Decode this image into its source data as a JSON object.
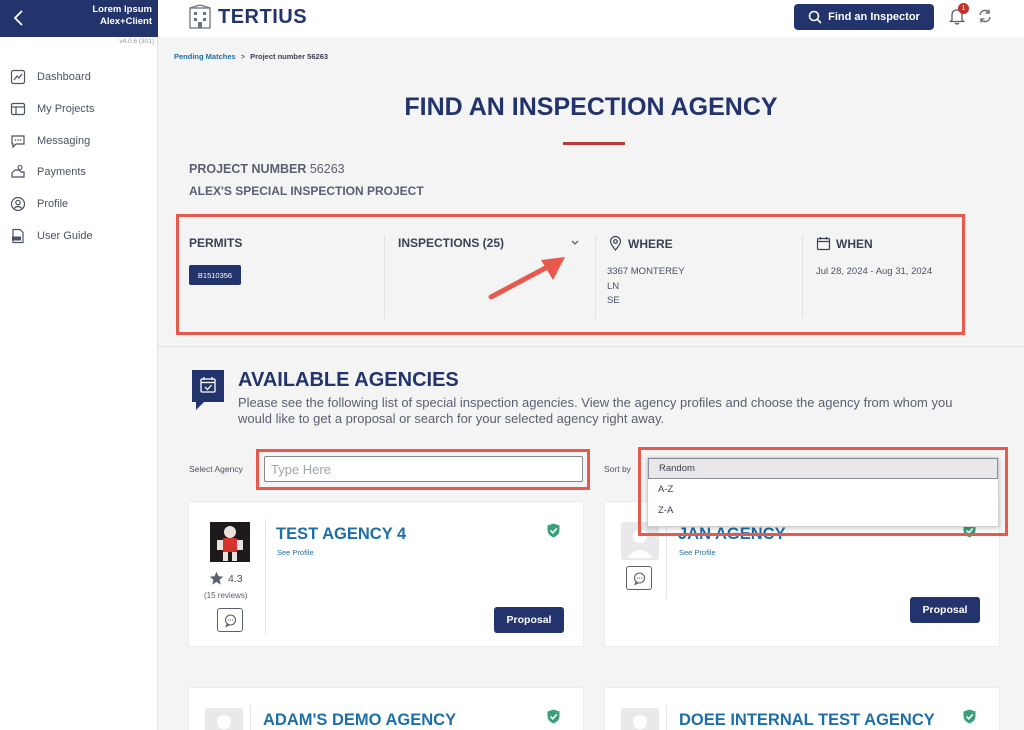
{
  "sidebar": {
    "user_line1": "Lorem Ipsum",
    "user_line2": "Alex+Client",
    "version": "v4.0.6 (301)",
    "items": [
      {
        "label": "Dashboard"
      },
      {
        "label": "My Projects"
      },
      {
        "label": "Messaging"
      },
      {
        "label": "Payments"
      },
      {
        "label": "Profile"
      },
      {
        "label": "User Guide"
      }
    ]
  },
  "topbar": {
    "logo_text": "TERTIUS",
    "find_button": "Find an Inspector",
    "notification_count": "1"
  },
  "breadcrumb": {
    "parent": "Pending Matches",
    "separator": ">",
    "current": "Project number 56263"
  },
  "page": {
    "title": "FIND AN INSPECTION AGENCY",
    "project_number_label": "PROJECT NUMBER",
    "project_number": "56263",
    "project_name": "ALEX'S SPECIAL INSPECTION PROJECT"
  },
  "details": {
    "permits_label": "PERMITS",
    "permit_id": "B1510356",
    "inspections_label": "INSPECTIONS (25)",
    "where_label": "WHERE",
    "address_line1": "3367 MONTEREY",
    "address_line2": "LN",
    "address_line3": "SE",
    "when_label": "WHEN",
    "date_range": "Jul 28, 2024 - Aug 31, 2024"
  },
  "agencies": {
    "title": "AVAILABLE AGENCIES",
    "description": "Please see the following list of special inspection agencies. View the agency profiles and choose the agency from whom you would like to get a proposal or search for your selected agency right away.",
    "select_label": "Select Agency",
    "select_placeholder": "Type Here",
    "sort_label": "Sort by",
    "sort_options": [
      "Random",
      "A-Z",
      "Z-A"
    ],
    "see_profile": "See Profile",
    "proposal_label": "Proposal",
    "cards": [
      {
        "name": "TEST AGENCY 4",
        "rating": "4.3",
        "reviews": "(15 reviews)"
      },
      {
        "name": "JAN AGENCY"
      },
      {
        "name": "ADAM'S DEMO AGENCY"
      },
      {
        "name": "DOEE INTERNAL TEST AGENCY"
      }
    ]
  },
  "colors": {
    "navy": "#22346b",
    "link_blue": "#1e6fa8",
    "accent_red": "#b83b33",
    "highlight_red": "#e8594d",
    "verified_green": "#3aa07a"
  }
}
